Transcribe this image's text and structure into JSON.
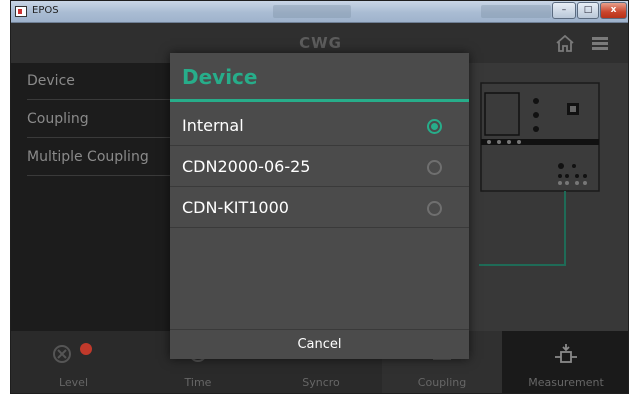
{
  "window": {
    "title": "EPOS",
    "buttons": {
      "minimize": "–",
      "maximize": "□",
      "close": "x"
    }
  },
  "header": {
    "title": "CWG",
    "icons": [
      "home-icon",
      "menu-icon"
    ]
  },
  "sidebar": {
    "items": [
      {
        "label": "Device"
      },
      {
        "label": "Coupling"
      },
      {
        "label": "Multiple Coupling"
      }
    ]
  },
  "toolbar": {
    "items": [
      {
        "label": "Level",
        "icon": "level-icon"
      },
      {
        "label": "Time",
        "icon": "time-icon"
      },
      {
        "label": "Syncro",
        "icon": "syncro-icon"
      },
      {
        "label": "Coupling",
        "icon": "coupling-icon"
      },
      {
        "label": "Measurement",
        "icon": "measurement-icon"
      }
    ]
  },
  "dialog": {
    "title": "Device",
    "options": [
      {
        "label": "Internal",
        "selected": true
      },
      {
        "label": "CDN2000-06-25",
        "selected": false
      },
      {
        "label": "CDN-KIT1000",
        "selected": false
      }
    ],
    "cancel_label": "Cancel"
  },
  "colors": {
    "accent": "#27ad8a",
    "alert": "#c0392b",
    "dialog_bg": "#4b4b4b",
    "sidebar_bg": "#1c1c1c"
  }
}
